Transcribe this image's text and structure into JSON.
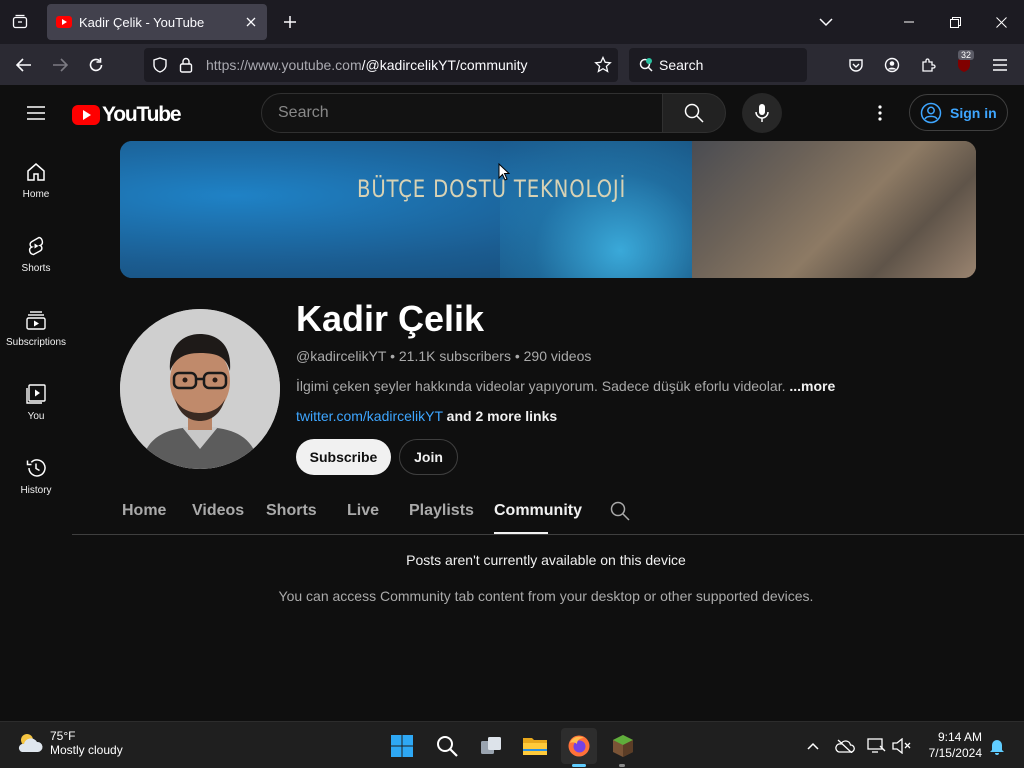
{
  "browser": {
    "tab_title": "Kadir Çelik - YouTube",
    "url_host": "https://www.youtube.com",
    "url_path": "/@kadircelikYT/community",
    "search_placeholder": "Search",
    "extension_badge": "32"
  },
  "yt": {
    "logo_text": "YouTube",
    "search_placeholder": "Search",
    "signin_label": "Sign in",
    "guide": [
      {
        "label": "Home"
      },
      {
        "label": "Shorts"
      },
      {
        "label": "Subscriptions"
      },
      {
        "label": "You"
      },
      {
        "label": "History"
      }
    ],
    "banner_text": "BÜTÇE DOSTU TEKNOLOJİ",
    "channel": {
      "name": "Kadir Çelik",
      "handle": "@kadircelikYT",
      "subscribers": "21.1K subscribers",
      "videos": "290 videos",
      "description": "İlgimi çeken şeyler hakkında videolar yapıyorum. Sadece düşük eforlu videolar.",
      "more": "...more",
      "link": "twitter.com/kadircelikYT",
      "more_links": "and 2 more links",
      "subscribe": "Subscribe",
      "join": "Join"
    },
    "tabs": [
      {
        "label": "Home"
      },
      {
        "label": "Videos"
      },
      {
        "label": "Shorts"
      },
      {
        "label": "Live"
      },
      {
        "label": "Playlists"
      },
      {
        "label": "Community"
      }
    ],
    "active_tab": "Community",
    "message_title": "Posts aren't currently available on this device",
    "message_body": "You can access Community tab content from your desktop or other supported devices."
  },
  "taskbar": {
    "temperature": "75°F",
    "weather": "Mostly cloudy",
    "time": "9:14 AM",
    "date": "7/15/2024"
  }
}
